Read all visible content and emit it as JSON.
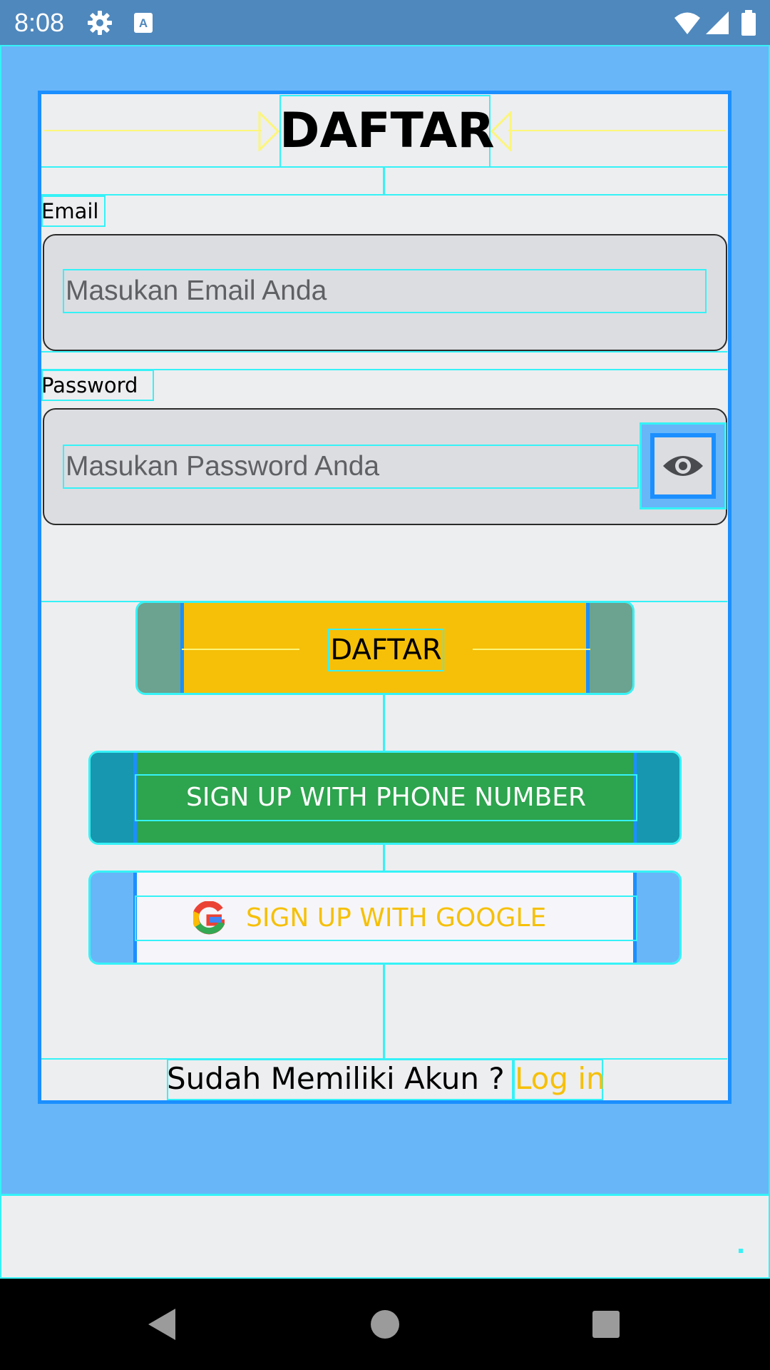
{
  "status_bar": {
    "time": "8:08",
    "icons": [
      "gear-icon",
      "keyboard-a-icon",
      "wifi-icon",
      "signal-icon",
      "battery-icon"
    ]
  },
  "form": {
    "title": "DAFTAR",
    "email_label": "Email",
    "email_placeholder": "Masukan Email Anda",
    "password_label": "Password",
    "password_placeholder": "Masukan Password Anda",
    "show_password_icon": "eye-icon"
  },
  "buttons": {
    "register_label": "DAFTAR",
    "phone_label": "SIGN UP WITH PHONE NUMBER",
    "google_label": "SIGN UP WITH GOOGLE",
    "google_icon": "google-logo-icon"
  },
  "footer": {
    "question": "Sudah Memiliki Akun ?",
    "login_link": "Log in"
  },
  "nav_bar": {
    "items": [
      "back-icon",
      "home-icon",
      "recents-icon"
    ]
  },
  "colors": {
    "app_background": "#68b6f8",
    "card_border": "#1b8fff",
    "register_button": "#f6c008",
    "phone_button": "#2da44e",
    "accent_text": "#f6c008",
    "debug_overlay": "#35f2f7"
  }
}
